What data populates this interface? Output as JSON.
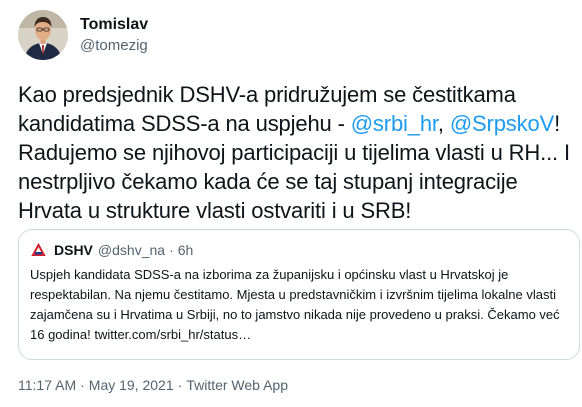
{
  "author": {
    "display_name": "Tomislav",
    "handle": "@tomezig",
    "avatar_icon": "profile-photo"
  },
  "tweet": {
    "segments": [
      {
        "text": "Kao predsjednik DSHV-a pridružujem se čestitkama kandidatima SDSS-a na uspjehu - "
      },
      {
        "text": "@srbi_hr",
        "mention": true
      },
      {
        "text": ", "
      },
      {
        "text": "@SrpskoV",
        "mention": true
      },
      {
        "text": "! Radujemo se njihovoj participaciji u tijelima vlasti u RH... I nestrpljivo čekamo kada će se taj stupanj integracije Hrvata u strukture vlasti ostvariti i u SRB!"
      }
    ]
  },
  "quoted": {
    "logo_icon": "dshv-logo",
    "name": "DSHV",
    "handle": "@dshv_na",
    "separator": "·",
    "age": "6h",
    "text": "Uspjeh kandidata SDSS-a na izborima za županijsku i općinsku vlast u Hrvatskoj je respektabilan. Na njemu čestitamo. Mjesta u predstavničkim i izvršnim tijelima lokalne vlasti zajamčena su i Hrvatima u Srbiji, no to jamstvo nikada nije provedeno u praksi. Čekamo već 16 godina! twitter.com/srbi_hr/status…"
  },
  "footer": {
    "time": "11:17 AM",
    "separator": "·",
    "date": "May 19, 2021",
    "source": "Twitter Web App"
  },
  "colors": {
    "link": "#1d9bf0",
    "secondary_text": "#536471",
    "border": "#cfd9de",
    "logo_red": "#d3202f"
  }
}
